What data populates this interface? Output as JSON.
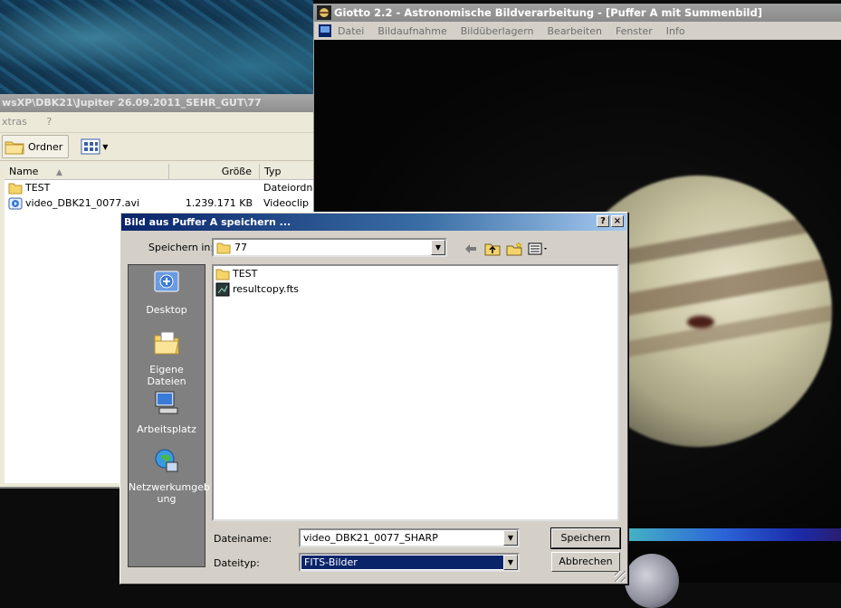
{
  "explorer": {
    "title": "wsXP\\DBK21\\Jupiter 26.09.2011_SEHR_GUT\\77",
    "menu": [
      "xtras",
      "?"
    ],
    "toolbar": {
      "folders_label": "Ordner"
    },
    "columns": {
      "name": "Name",
      "size": "Größe",
      "type": "Typ"
    },
    "files": [
      {
        "name": "TEST",
        "size": "",
        "type": "Dateiordner",
        "icon": "folder-icon"
      },
      {
        "name": "video_DBK21_0077.avi",
        "size": "1.239.171 KB",
        "type": "Videoclip",
        "icon": "video-file-icon"
      }
    ]
  },
  "giotto": {
    "title": "Giotto 2.2 - Astronomische Bildverarbeitung - [Puffer A mit Summenbild]",
    "menu": [
      "Datei",
      "Bildaufnahme",
      "Bildüberlagern",
      "Bearbeiten",
      "Fenster",
      "Info"
    ]
  },
  "dialog": {
    "title": "Bild aus Puffer A speichern ...",
    "help_button": "?",
    "close_button": "×",
    "save_in_label": "Speichern in:",
    "save_in_value": "77",
    "places": [
      "Desktop",
      "Eigene Dateien",
      "Arbeitsplatz",
      "Netzwerkumgeb ung"
    ],
    "files": [
      {
        "name": "TEST",
        "icon": "folder-icon"
      },
      {
        "name": "resultcopy.fts",
        "icon": "fits-file-icon"
      }
    ],
    "filename_label": "Dateiname:",
    "filename_value": "video_DBK21_0077_SHARP",
    "filetype_label": "Dateityp:",
    "filetype_value": "FITS-Bilder",
    "save_button": "Speichern",
    "cancel_button": "Abbrechen"
  },
  "colors": {
    "dialog_title_start": "#0a246a",
    "dialog_title_end": "#a6caf0",
    "selection": "#0a246a",
    "face": "#d4d0c8"
  }
}
